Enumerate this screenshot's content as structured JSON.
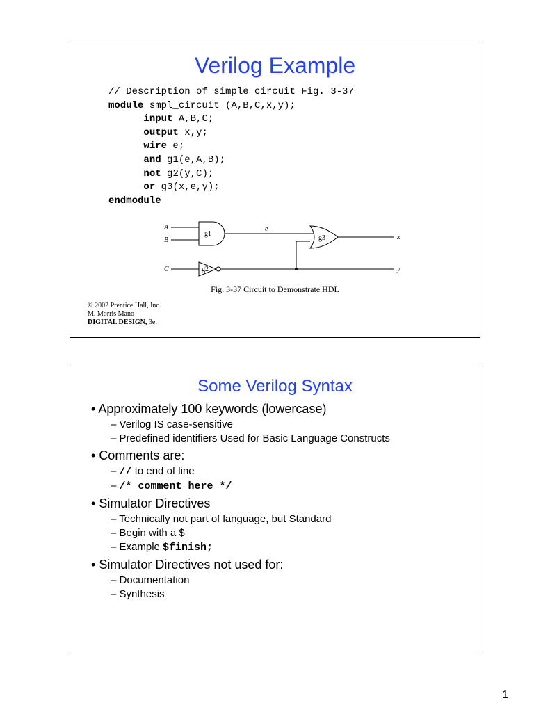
{
  "page_number": "1",
  "slide1": {
    "title": "Verilog Example",
    "code": {
      "l1": "// Description of simple circuit Fig. 3-37",
      "l2a": "module",
      "l2b": " smpl_circuit (A,B,C,x,y);",
      "l3a": "input",
      "l3b": " A,B,C;",
      "l4a": "output",
      "l4b": " x,y;",
      "l5a": "wire",
      "l5b": " e;",
      "l6a": "and",
      "l6b": " g1(e,A,B);",
      "l7a": "not",
      "l7b": " g2(y,C);",
      "l8a": "or",
      "l8b": " g3(x,e,y);",
      "l9": "endmodule"
    },
    "circuit": {
      "A": "A",
      "B": "B",
      "C": "C",
      "e": "e",
      "x": "x",
      "y": "y",
      "g1": "g1",
      "g2": "g2",
      "g3": "g3",
      "caption": "Fig. 3-37  Circuit to Demonstrate HDL"
    },
    "citation": {
      "line1": "© 2002 Prentice Hall, Inc.",
      "line2": "M. Morris Mano",
      "line3": "DIGITAL DESIGN, 3e.",
      "line3_prefix": "DIGITAL DESIGN,",
      "line3_suffix": " 3e."
    }
  },
  "slide2": {
    "title": "Some Verilog Syntax",
    "b1": "Approximately 100 keywords (lowercase)",
    "b1s1": "Verilog IS case-sensitive",
    "b1s2": "Predefined identifiers Used for Basic Language Constructs",
    "b2": "Comments are:",
    "b2s1a": "//",
    "b2s1b": " to end of line",
    "b2s2": "/* comment here */",
    "b3": "Simulator Directives",
    "b3s1": "Technically not part of language, but Standard",
    "b3s2": "Begin with a $",
    "b3s3a": "Example ",
    "b3s3b": "$finish;",
    "b4": "Simulator Directives not used for:",
    "b4s1": "Documentation",
    "b4s2": "Synthesis"
  }
}
